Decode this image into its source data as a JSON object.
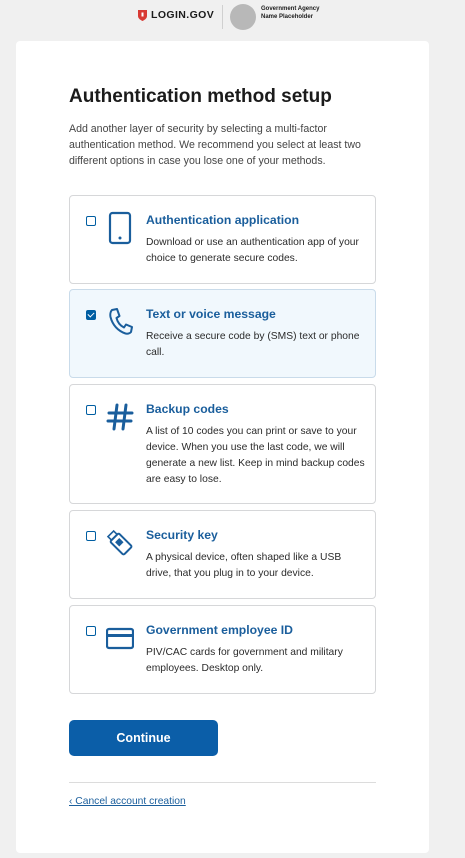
{
  "header": {
    "brand": "LOGIN.GOV",
    "agency_name": "Government Agency Name Placeholder"
  },
  "main": {
    "title": "Authentication method setup",
    "intro": "Add another layer of security by selecting a multi-factor authentication method. We recommend you select at least two different options in case you lose one of your methods.",
    "options": [
      {
        "title": "Authentication application",
        "description": "Download or use an authentication app of your choice to generate secure codes.",
        "checked": false,
        "icon": "phone-icon"
      },
      {
        "title": "Text or voice message",
        "description": "Receive a secure code by (SMS) text or phone call.",
        "checked": true,
        "icon": "telephone-icon"
      },
      {
        "title": "Backup codes",
        "description": "A list of 10 codes you can print or save to your device. When you use the last code, we will generate a new list. Keep in mind backup codes are easy to lose.",
        "checked": false,
        "icon": "hashtag-icon"
      },
      {
        "title": "Security key",
        "description": "A physical device, often shaped like a USB drive, that you plug in to your device.",
        "checked": false,
        "icon": "usb-key-icon"
      },
      {
        "title": "Government employee ID",
        "description": "PIV/CAC cards for government and military employees. Desktop only.",
        "checked": false,
        "icon": "id-card-icon"
      }
    ],
    "continue_label": "Continue",
    "cancel_label": "‹ Cancel account creation"
  },
  "colors": {
    "accent": "#005ea2",
    "button": "#0b5ea8",
    "selected_bg": "#f1f8fd"
  }
}
